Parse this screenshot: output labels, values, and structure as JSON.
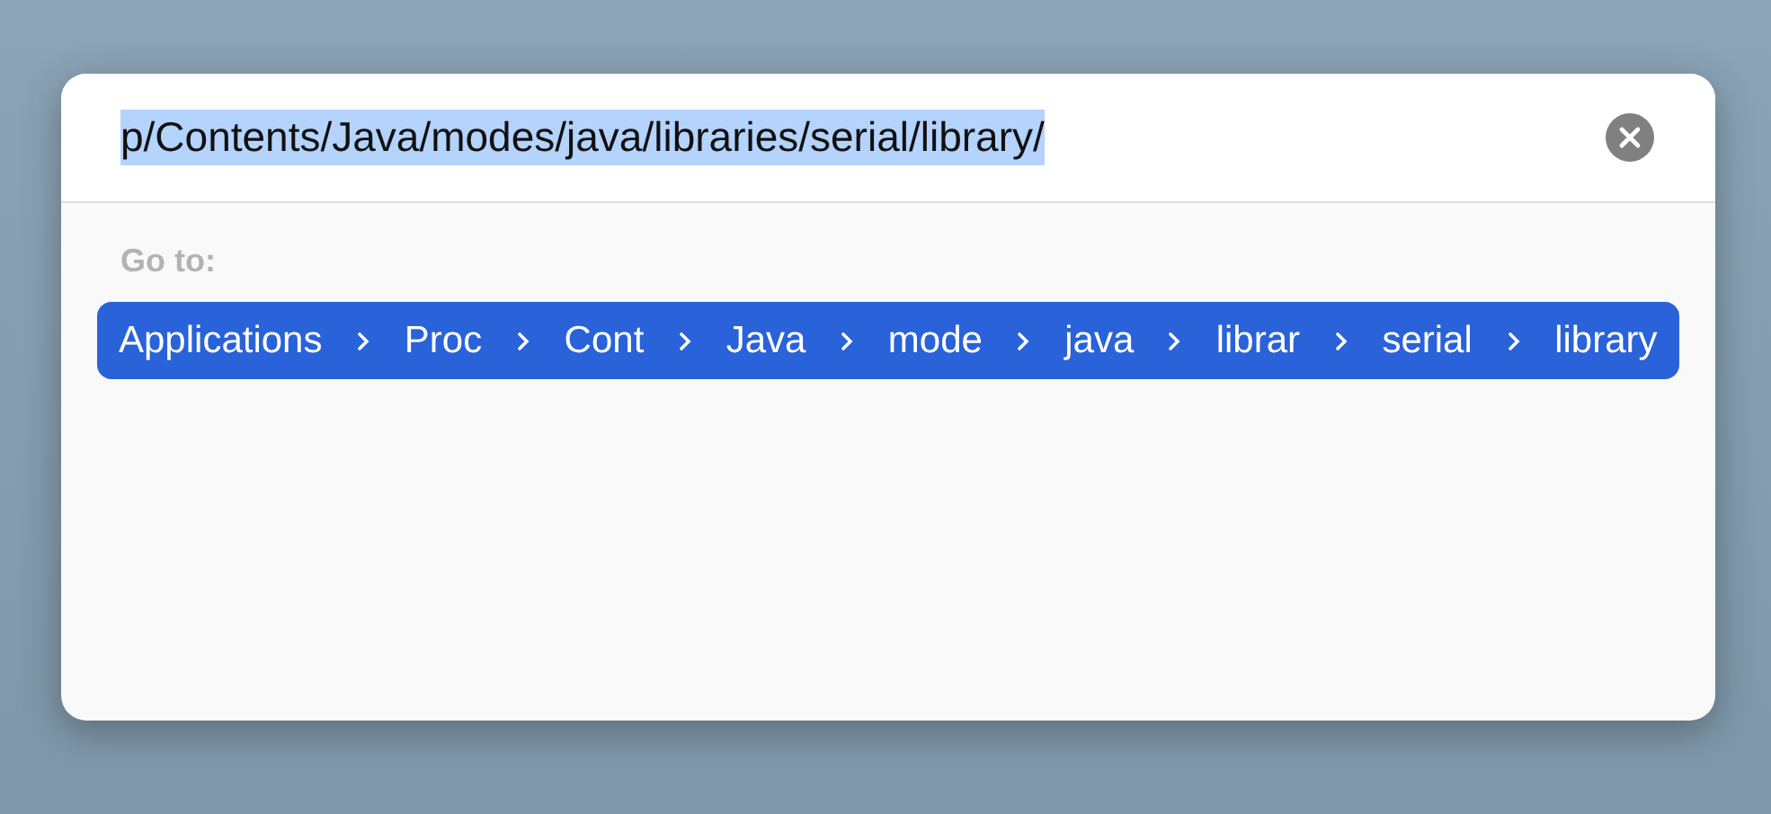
{
  "field": {
    "value": "p/Contents/Java/modes/java/libraries/serial/library/",
    "selected": true
  },
  "goto_label": "Go to:",
  "path": [
    {
      "label": "Applications"
    },
    {
      "label": "Proc"
    },
    {
      "label": "Cont"
    },
    {
      "label": "Java"
    },
    {
      "label": "mode"
    },
    {
      "label": "java"
    },
    {
      "label": "librar"
    },
    {
      "label": "serial"
    },
    {
      "label": "library"
    }
  ]
}
